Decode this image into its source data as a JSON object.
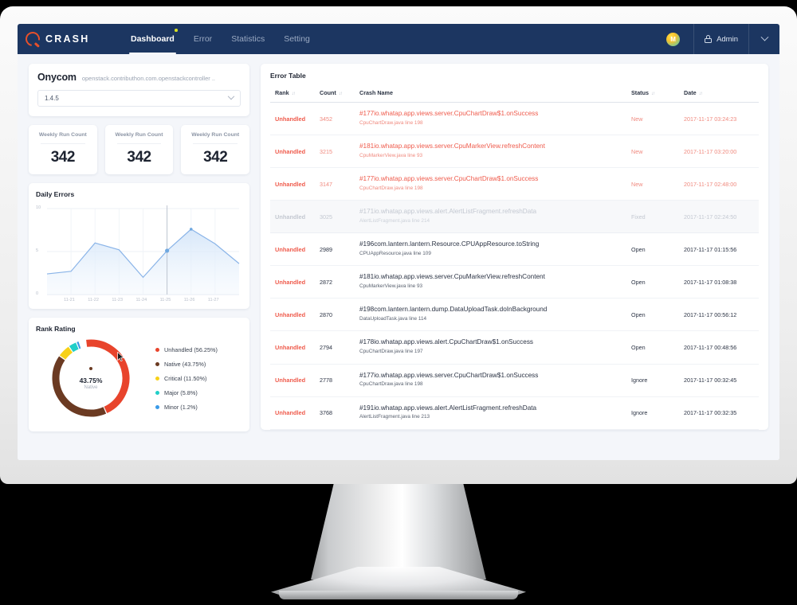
{
  "topbar": {
    "logo_text": "CRASH",
    "nav": [
      {
        "label": "Dashboard",
        "active": true,
        "dot": true
      },
      {
        "label": "Error",
        "active": false,
        "dot": false
      },
      {
        "label": "Statistics",
        "active": false,
        "dot": false
      },
      {
        "label": "Setting",
        "active": false,
        "dot": false
      }
    ],
    "avatar_initial": "M",
    "admin_label": "Admin"
  },
  "project": {
    "name": "Onycom",
    "url": "openstack.contributhon.com.openstackcontroller ..",
    "version_value": "1.4.5"
  },
  "stats": [
    {
      "label": "Weekly Run Count",
      "value": "342"
    },
    {
      "label": "Weekly Run Count",
      "value": "342"
    },
    {
      "label": "Weekly Run Count",
      "value": "342"
    }
  ],
  "daily_errors": {
    "title": "Daily Errors"
  },
  "rank_rating": {
    "title": "Rank Rating",
    "center_value": "43.75%",
    "center_label": "Native",
    "legend": [
      {
        "label": "Unhandled (56.25%)",
        "color": "#e8442c"
      },
      {
        "label": "Native (43.75%)",
        "color": "#6b3a22"
      },
      {
        "label": "Critical (11.50%)",
        "color": "#f7d117"
      },
      {
        "label": "Major (5.8%)",
        "color": "#21cfc8"
      },
      {
        "label": "Minor (1.2%)",
        "color": "#3a9ae8"
      }
    ]
  },
  "error_table": {
    "title": "Error Table",
    "sort_glyph": "↓↑",
    "columns": [
      "Rank",
      "Count",
      "Crash Name",
      "Status",
      "Date"
    ],
    "rows": [
      {
        "rank": "Unhandled",
        "count": "3452",
        "name": "#177io.whatap.app.views.server.CpuChartDraw$1.onSuccess",
        "sub": "CpuChartDraw.java line 198",
        "status": "New",
        "date": "2017-11-17 03:24:23",
        "tone": "red"
      },
      {
        "rank": "Unhandled",
        "count": "3215",
        "name": "#181io.whatap.app.views.server.CpuMarkerView.refreshContent",
        "sub": "CpuMarkerView.java line 93",
        "status": "New",
        "date": "2017-11-17 03:20:00",
        "tone": "red"
      },
      {
        "rank": "Unhandled",
        "count": "3147",
        "name": "#177io.whatap.app.views.server.CpuChartDraw$1.onSuccess",
        "sub": "CpuChartDraw.java line 198",
        "status": "New",
        "date": "2017-11-17 02:48:00",
        "tone": "red"
      },
      {
        "rank": "Unhandled",
        "count": "3025",
        "name": "#171io.whatap.app.views.alert.AlertListFragment.refreshData",
        "sub": "AlertListFragment.java line 214",
        "status": "Fixed",
        "date": "2017-11-17 02:24:50",
        "tone": "grey"
      },
      {
        "rank": "Unhandled",
        "count": "2989",
        "name": "#196com.lantern.lantern.Resource.CPUAppResource.toString",
        "sub": "CPUAppResource.java line 109",
        "status": "Open",
        "date": "2017-11-17 01:15:56",
        "tone": "dark"
      },
      {
        "rank": "Unhandled",
        "count": "2872",
        "name": "#181io.whatap.app.views.server.CpuMarkerView.refreshContent",
        "sub": "CpuMarkerView.java line 93",
        "status": "Open",
        "date": "2017-11-17 01:08:38",
        "tone": "dark"
      },
      {
        "rank": "Unhandled",
        "count": "2870",
        "name": "#198com.lantern.lantern.dump.DataUploadTask.doInBackground",
        "sub": "DataUploadTask.java line 114",
        "status": "Open",
        "date": "2017-11-17 00:56:12",
        "tone": "dark"
      },
      {
        "rank": "Unhandled",
        "count": "2794",
        "name": "#178io.whatap.app.views.alert.CpuChartDraw$1.onSuccess",
        "sub": "CpuChartDraw.java line 197",
        "status": "Open",
        "date": "2017-11-17 00:48:56",
        "tone": "dark"
      },
      {
        "rank": "Unhandled",
        "count": "2778",
        "name": "#177io.whatap.app.views.server.CpuChartDraw$1.onSuccess",
        "sub": "CpuChartDraw.java line 198",
        "status": "Ignore",
        "date": "2017-11-17 00:32:45",
        "tone": "dark"
      },
      {
        "rank": "Unhandled",
        "count": "3768",
        "name": "#191io.whatap.app.views.alert.AlertListFragment.refreshData",
        "sub": "AlertListFragment.java line 213",
        "status": "Ignore",
        "date": "2017-11-17 00:32:35",
        "tone": "dark"
      }
    ]
  },
  "chart_data": [
    {
      "type": "area",
      "title": "Daily Errors",
      "xlabel": "",
      "ylabel": "",
      "x": [
        "",
        "11-21",
        "11-22",
        "11-23",
        "11-24",
        "11-25",
        "11-26",
        "11-27",
        ""
      ],
      "values": [
        2.4,
        2.7,
        6.0,
        5.2,
        2.0,
        5.1,
        7.6,
        5.9,
        3.6
      ],
      "ylim": [
        0,
        10
      ],
      "yticks": [
        0,
        5,
        10
      ],
      "ytick_labels": [
        "0",
        "5",
        "10"
      ],
      "grid": true,
      "legend": "none",
      "line_color": "#8ab4e8",
      "fill_color": "#dce9f8",
      "highlight_point": {
        "x": "11-25",
        "y": 5.1
      }
    },
    {
      "type": "pie",
      "title": "Rank Rating",
      "labels": [
        "Unhandled (56.25%)",
        "Native (43.75%)",
        "Critical (11.50%)",
        "Major (5.8%)",
        "Minor (1.2%)"
      ],
      "values": [
        56.25,
        43.75,
        11.5,
        5.8,
        1.2
      ],
      "colors": [
        "#e8442c",
        "#6b3a22",
        "#f7d117",
        "#21cfc8",
        "#3a9ae8"
      ],
      "center_value": "43.75%",
      "center_label": "Native",
      "legend": "right",
      "donut": true
    }
  ]
}
